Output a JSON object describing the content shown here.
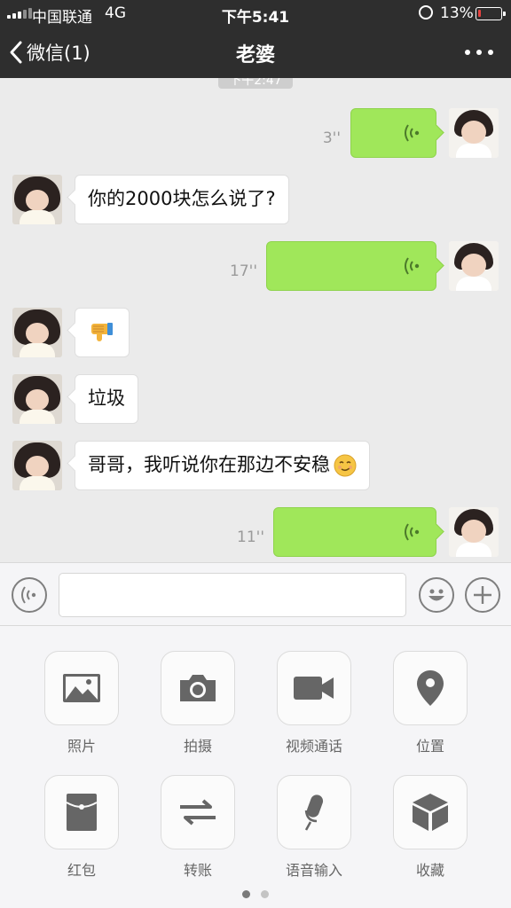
{
  "status_bar": {
    "carrier": "中国联通",
    "network": "4G",
    "time": "下午5:41",
    "battery_percent": "13%",
    "battery_level": 0.13
  },
  "nav": {
    "back_label": "微信(1)",
    "title": "老婆",
    "more_icon": "more-dots-icon"
  },
  "chat": {
    "timestamp_partial": "下午2:47",
    "messages": [
      {
        "side": "out",
        "type": "voice",
        "duration": "3''"
      },
      {
        "side": "in",
        "type": "text",
        "text": "你的2000块怎么说了?"
      },
      {
        "side": "out",
        "type": "voice",
        "duration": "17''"
      },
      {
        "side": "in",
        "type": "emoji",
        "emoji": "thumbs-down-emoji"
      },
      {
        "side": "in",
        "type": "text",
        "text": "垃圾"
      },
      {
        "side": "in",
        "type": "text",
        "text": "哥哥，我听说你在那边不安稳",
        "emoji": "smirk-emoji"
      },
      {
        "side": "out",
        "type": "voice",
        "duration": "11''"
      }
    ]
  },
  "input_bar": {
    "voice_icon": "voice-mode-icon",
    "text_value": "",
    "emoji_icon": "smiley-icon",
    "plus_icon": "plus-icon"
  },
  "panel": {
    "tools": [
      {
        "label": "照片",
        "icon": "photo-icon"
      },
      {
        "label": "拍摄",
        "icon": "camera-icon"
      },
      {
        "label": "视频通话",
        "icon": "video-call-icon"
      },
      {
        "label": "位置",
        "icon": "location-icon"
      },
      {
        "label": "红包",
        "icon": "red-packet-icon"
      },
      {
        "label": "转账",
        "icon": "transfer-icon"
      },
      {
        "label": "语音输入",
        "icon": "microphone-icon"
      },
      {
        "label": "收藏",
        "icon": "favorites-icon"
      }
    ],
    "page_count": 2,
    "active_page": 1
  },
  "colors": {
    "bar_bg": "#2e2e2e",
    "chat_bg": "#ebebeb",
    "out_bubble": "#a0e75a",
    "in_bubble": "#ffffff",
    "battery_low": "#e64340"
  }
}
